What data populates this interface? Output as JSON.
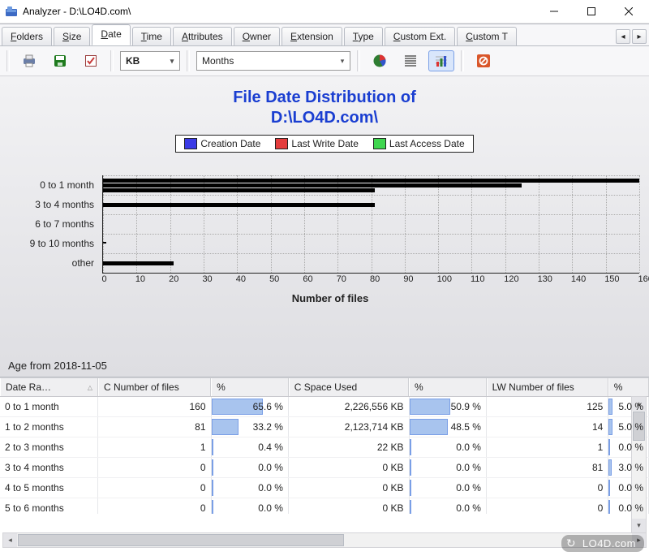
{
  "window": {
    "title": "Analyzer - D:\\LO4D.com\\"
  },
  "tabs": [
    "Folders",
    "Size",
    "Date",
    "Time",
    "Attributes",
    "Owner",
    "Extension",
    "Type",
    "Custom Ext.",
    "Custom T"
  ],
  "active_tab_index": 2,
  "toolbar": {
    "kb_label": "KB",
    "select_value": "Months"
  },
  "chart_data": {
    "type": "bar",
    "title_line1": "File Date Distribution of",
    "title_line2": "D:\\LO4D.com\\",
    "legend": [
      "Creation Date",
      "Last Write Date",
      "Last Access Date"
    ],
    "xlabel": "Number of files",
    "xlim": [
      0,
      160
    ],
    "xticks": [
      0,
      10,
      20,
      30,
      40,
      50,
      60,
      70,
      80,
      90,
      100,
      110,
      120,
      130,
      140,
      150,
      160
    ],
    "categories": [
      "0 to 1 month",
      "3 to 4 months",
      "6 to 7 months",
      "9 to 10 months",
      "other"
    ],
    "series": [
      {
        "name": "Creation Date",
        "values": [
          160,
          0,
          0,
          0,
          0
        ]
      },
      {
        "name": "Last Write Date",
        "values": [
          125,
          81,
          0,
          1,
          21
        ]
      },
      {
        "name": "Last Access Date",
        "values": [
          81,
          0,
          0,
          0,
          0
        ]
      }
    ],
    "note": "Age from 2018-11-05"
  },
  "table": {
    "columns": [
      "Date Ra…",
      "C Number of files",
      "%",
      "C Space Used",
      "%",
      "LW Number of files",
      "%"
    ],
    "sort_col": 0,
    "rows": [
      {
        "range": "0 to 1 month",
        "c_files": 160,
        "c_pct": 65.6,
        "c_space": "2,226,556 KB",
        "c_sp_pct": 50.9,
        "lw_files": 125,
        "lw_pct": 5
      },
      {
        "range": "1 to 2 months",
        "c_files": 81,
        "c_pct": 33.2,
        "c_space": "2,123,714 KB",
        "c_sp_pct": 48.5,
        "lw_files": 14,
        "lw_pct": 5
      },
      {
        "range": "2 to 3 months",
        "c_files": 1,
        "c_pct": 0.4,
        "c_space": "22 KB",
        "c_sp_pct": 0.0,
        "lw_files": 1,
        "lw_pct": 0
      },
      {
        "range": "3 to 4 months",
        "c_files": 0,
        "c_pct": 0.0,
        "c_space": "0 KB",
        "c_sp_pct": 0.0,
        "lw_files": 81,
        "lw_pct": 3
      },
      {
        "range": "4 to 5 months",
        "c_files": 0,
        "c_pct": 0.0,
        "c_space": "0 KB",
        "c_sp_pct": 0.0,
        "lw_files": 0,
        "lw_pct": 0
      },
      {
        "range": "5 to 6 months",
        "c_files": 0,
        "c_pct": 0.0,
        "c_space": "0 KB",
        "c_sp_pct": 0.0,
        "lw_files": 0,
        "lw_pct": 0
      }
    ]
  },
  "watermark": "LO4D.com"
}
